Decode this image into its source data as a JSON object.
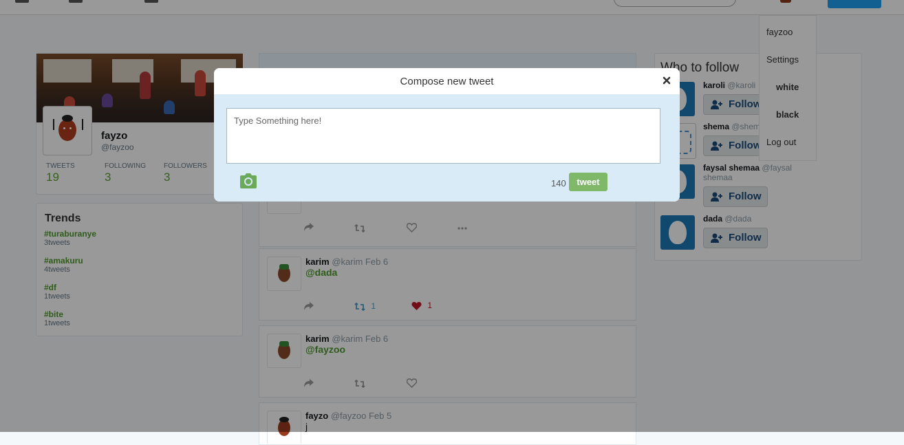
{
  "profile": {
    "name": "fayzo",
    "handle": "@fayzoo",
    "stats": [
      {
        "label": "Tweets",
        "value": "19"
      },
      {
        "label": "Following",
        "value": "3"
      },
      {
        "label": "Followers",
        "value": "3"
      }
    ]
  },
  "trends": {
    "title": "Trends",
    "items": [
      {
        "tag": "#turaburanye",
        "count": "3tweets"
      },
      {
        "tag": "#amakuru",
        "count": "4tweets"
      },
      {
        "tag": "#df",
        "count": "1tweets"
      },
      {
        "tag": "#bite",
        "count": "1tweets"
      }
    ]
  },
  "tweets": [
    {
      "name": "karim",
      "meta": "@karim Feb 6",
      "text": "@dada",
      "retweets": "1",
      "likes": "1"
    },
    {
      "name": "karim",
      "meta": "@karim Feb 6",
      "text": "@fayzoo"
    },
    {
      "name": "fayzo",
      "meta": "@fayzoo Feb 5",
      "text": "j"
    }
  ],
  "who_to_follow": {
    "title": "Who to follow",
    "follow_label": "Follow",
    "items": [
      {
        "name": "karoli",
        "handle": "@karoli"
      },
      {
        "name": "shema",
        "handle": "@shema"
      },
      {
        "name": "faysal shemaa",
        "handle": "@faysal",
        "handle2": "shemaa"
      },
      {
        "name": "dada",
        "handle": "@dada"
      }
    ]
  },
  "menu": {
    "items": [
      "fayzoo",
      "Settings",
      "white",
      "black",
      "Log out"
    ]
  },
  "modal": {
    "title": "Compose new tweet",
    "placeholder": "Type Something here!",
    "char_count": "140",
    "tweet_label": "tweet"
  },
  "colors": {
    "accent_green": "#80b86a",
    "link_green": "#4f9a2e",
    "modal_body_bg": "#daebf8"
  }
}
